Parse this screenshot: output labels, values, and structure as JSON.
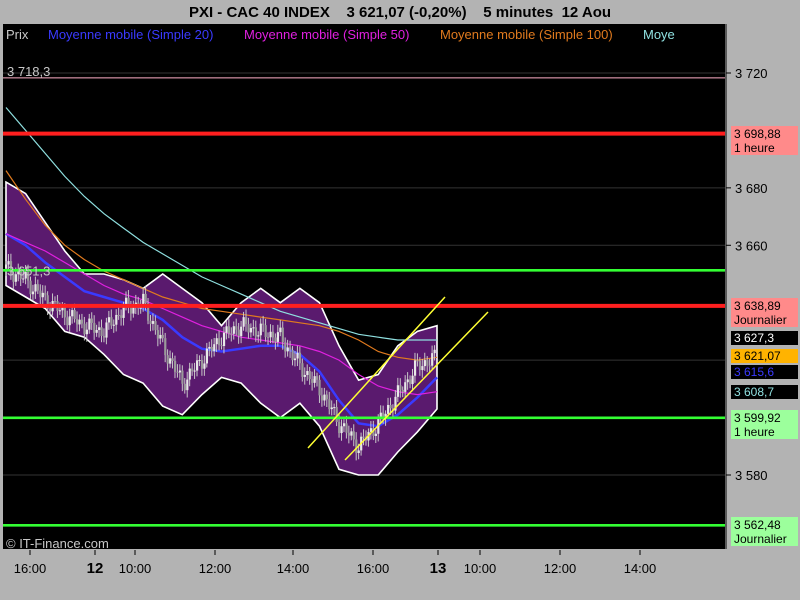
{
  "header": {
    "title": "PXI - CAC 40 INDEX    3 621,07 (-0,20%)    5 minutes  12 Aou"
  },
  "legend": [
    {
      "label": "Prix",
      "color": "#c8c8c8"
    },
    {
      "label": "Moyenne mobile (Simple 20)",
      "color": "#3a3aff"
    },
    {
      "label": "Moyenne mobile (Simple 50)",
      "color": "#e020e0"
    },
    {
      "label": "Moyenne mobile (Simple 100)",
      "color": "#e07a1e"
    },
    {
      "label": "Moye",
      "color": "#8fe0e0"
    }
  ],
  "copyright": "© IT-Finance.com",
  "colors": {
    "background": "#000000",
    "axis_panel": "#b3b3b3",
    "support": "#33ff33",
    "resistance": "#ff1f1f",
    "channel": "#ffff33",
    "band_fill": "#5a1a6e",
    "band_edge": "#ffffff"
  },
  "chart_data": {
    "type": "candlestick",
    "interval": "5 minutes",
    "y_axis_ticks": [
      "3 720",
      "3 680",
      "3 660",
      "3 580"
    ],
    "y_axis_tick_values": [
      3720,
      3680,
      3660,
      3580
    ],
    "ylim": [
      3558,
      3728
    ],
    "x_axis_ticks": [
      {
        "label": "16:00",
        "bold": false
      },
      {
        "label": "12",
        "bold": true
      },
      {
        "label": "10:00",
        "bold": false
      },
      {
        "label": "12:00",
        "bold": false
      },
      {
        "label": "14:00",
        "bold": false
      },
      {
        "label": "16:00",
        "bold": false
      },
      {
        "label": "13",
        "bold": true
      },
      {
        "label": "10:00",
        "bold": false
      },
      {
        "label": "12:00",
        "bold": false
      },
      {
        "label": "14:00",
        "bold": false
      }
    ],
    "annotations": [
      {
        "text": "3 718,3",
        "value": 3718.3
      },
      {
        "text": "3 651,3",
        "value": 3651.3
      }
    ],
    "horizontal_levels": [
      {
        "value": 3698.88,
        "label": "3 698,88",
        "sublabel": "1 heure",
        "kind": "resistance"
      },
      {
        "value": 3638.89,
        "label": "3 638,89",
        "sublabel": "Journalier",
        "kind": "resistance"
      },
      {
        "value": 3651.3,
        "label": "",
        "sublabel": "",
        "kind": "support"
      },
      {
        "value": 3599.92,
        "label": "3 599,92",
        "sublabel": "1 heure",
        "kind": "support"
      },
      {
        "value": 3562.48,
        "label": "3 562,48",
        "sublabel": "Journalier",
        "kind": "support"
      }
    ],
    "price_tags": [
      {
        "text": "3 627,3",
        "value": 3627.3,
        "bg": "#000000",
        "fg": "#ffffff"
      },
      {
        "text": "3 621,07",
        "value": 3621.07,
        "bg": "#ffb300",
        "fg": "#000000"
      },
      {
        "text": "3 615,6",
        "value": 3615.6,
        "bg": "#000000",
        "fg": "#3a3aff"
      },
      {
        "text": "3 608,7",
        "value": 3608.7,
        "bg": "#000000",
        "fg": "#8fe0e0"
      }
    ],
    "series": [
      {
        "name": "Moyenne mobile (Simple 20)",
        "color": "#3a3aff",
        "values": [
          3664,
          3660,
          3654,
          3649,
          3644,
          3642,
          3640,
          3638,
          3634,
          3628,
          3624,
          3623,
          3624,
          3625,
          3625,
          3622,
          3616,
          3606,
          3598,
          3597,
          3601,
          3607,
          3614
        ]
      },
      {
        "name": "Moyenne mobile (Simple 50)",
        "color": "#e020e0",
        "values": [
          3664,
          3661,
          3658,
          3654,
          3650,
          3646,
          3643,
          3641,
          3638,
          3635,
          3632,
          3630,
          3628,
          3627,
          3626,
          3625,
          3623,
          3620,
          3615,
          3611,
          3609,
          3608,
          3609
        ]
      },
      {
        "name": "Moyenne mobile (Simple 100)",
        "color": "#e07a1e",
        "values": [
          3686,
          3676,
          3667,
          3660,
          3655,
          3651,
          3648,
          3645,
          3642,
          3640,
          3638,
          3637,
          3636,
          3635,
          3634,
          3633,
          3632,
          3630,
          3627,
          3623,
          3621,
          3620,
          3621
        ]
      },
      {
        "name": "Moye",
        "color": "#8fe0e0",
        "values": [
          3708,
          3700,
          3692,
          3684,
          3677,
          3671,
          3666,
          3661,
          3657,
          3653,
          3649,
          3646,
          3643,
          3640,
          3637,
          3635,
          3633,
          3631,
          3629,
          3628,
          3627,
          3627,
          3627
        ]
      }
    ],
    "band_upper": [
      3682,
      3678,
      3668,
      3658,
      3650,
      3650,
      3648,
      3645,
      3650,
      3645,
      3640,
      3632,
      3640,
      3645,
      3640,
      3645,
      3640,
      3625,
      3613,
      3615,
      3625,
      3630,
      3632
    ],
    "band_lower": [
      3646,
      3642,
      3638,
      3630,
      3628,
      3622,
      3615,
      3612,
      3604,
      3601,
      3608,
      3614,
      3612,
      3605,
      3600,
      3605,
      3597,
      3582,
      3580,
      3580,
      3588,
      3595,
      3603
    ],
    "close": [
      3652,
      3648,
      3641,
      3636,
      3632,
      3630,
      3638,
      3640,
      3625,
      3612,
      3620,
      3628,
      3632,
      3630,
      3628,
      3618,
      3610,
      3598,
      3590,
      3598,
      3608,
      3618,
      3621
    ],
    "channel_lines": [
      {
        "from": [
          3589,
          3639
        ],
        "to": [
          0,
          0
        ]
      },
      {
        "from": [
          3582,
          3636
        ],
        "to": [
          0,
          0
        ]
      }
    ]
  }
}
